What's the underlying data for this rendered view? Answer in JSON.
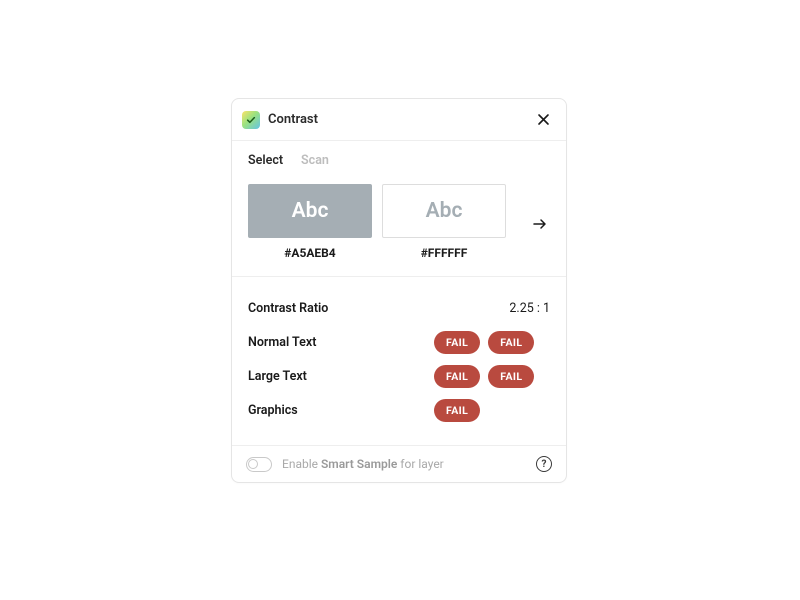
{
  "title": "Contrast",
  "tabs": {
    "select": "Select",
    "scan": "Scan",
    "active": "select"
  },
  "swatch_text": "Abc",
  "foreground": {
    "hex": "#A5AEB4"
  },
  "background": {
    "hex": "#FFFFFF"
  },
  "ratio_label": "Contrast Ratio",
  "ratio_value": "2.25 : 1",
  "tests": {
    "normal_text": {
      "label": "Normal Text",
      "aa": "FAIL",
      "aaa": "FAIL"
    },
    "large_text": {
      "label": "Large Text",
      "aa": "FAIL",
      "aaa": "FAIL"
    },
    "graphics": {
      "label": "Graphics",
      "aa": "FAIL"
    }
  },
  "footer": {
    "prefix": "Enable ",
    "strong": "Smart Sample",
    "suffix": " for layer"
  },
  "colors": {
    "fail_badge": "#B94A3F",
    "foreground_swatch": "#A5AEB4",
    "background_swatch": "#FFFFFF"
  }
}
